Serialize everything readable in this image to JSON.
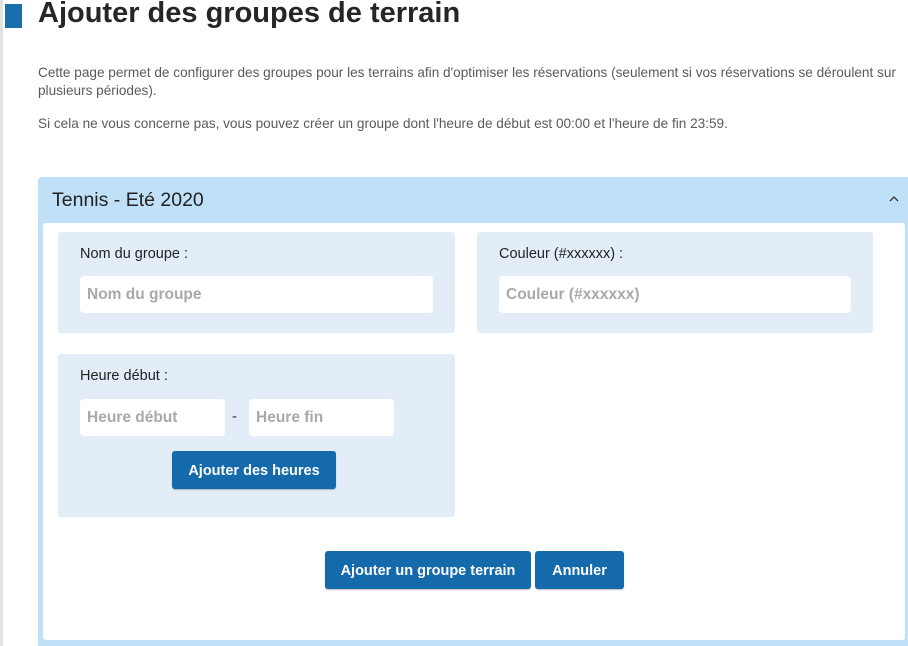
{
  "page": {
    "title": "Ajouter des groupes de terrain",
    "description_1": "Cette page permet de configurer des groupes pour les terrains afin d'optimiser les réservations (seulement si vos réservations se déroulent sur plusieurs périodes).",
    "description_2": "Si cela ne vous concerne pas, vous pouvez créer un groupe dont l'heure de début est 00:00 et l'heure de fin 23:59."
  },
  "panel": {
    "title": "Tennis - Eté 2020",
    "collapse_icon": "chevron-up-icon",
    "colors": {
      "header_bg": "#bfe0f7",
      "card_bg": "#e2edf8",
      "button_bg": "#156aab"
    }
  },
  "form": {
    "group_name": {
      "label": "Nom du groupe :",
      "value": "",
      "placeholder": "Nom du groupe"
    },
    "color": {
      "label": "Couleur (#xxxxxx) :",
      "value": "",
      "placeholder": "Couleur (#xxxxxx)"
    },
    "hours": {
      "label": "Heure début :",
      "start_placeholder": "Heure début",
      "end_placeholder": "Heure fin",
      "separator": "-",
      "add_button": "Ajouter des heures"
    }
  },
  "actions": {
    "add_group": "Ajouter un groupe terrain",
    "cancel": "Annuler"
  }
}
